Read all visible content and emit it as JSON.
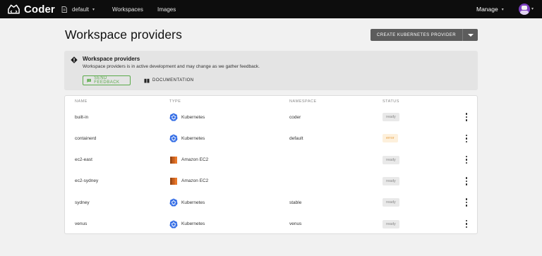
{
  "topbar": {
    "brand": "Coder",
    "org": "default",
    "nav": [
      "Workspaces",
      "Images"
    ],
    "manage": "Manage"
  },
  "header": {
    "title": "Workspace providers",
    "create_button": "CREATE KUBERNETES PROVIDER"
  },
  "alert": {
    "title": "Workspace providers",
    "body": "Workspace providers is in active development and may change as we gather feedback.",
    "feedback_button": "SEND FEEDBACK",
    "docs_button": "DOCUMENTATION"
  },
  "table": {
    "columns": [
      "NAME",
      "TYPE",
      "NAMESPACE",
      "STATUS"
    ],
    "rows": [
      {
        "name": "built-in",
        "type": "Kubernetes",
        "icon": "kubernetes-icon",
        "namespace": "coder",
        "status": "ready"
      },
      {
        "name": "containerd",
        "type": "Kubernetes",
        "icon": "kubernetes-icon",
        "namespace": "default",
        "status": "error"
      },
      {
        "name": "ec2-east",
        "type": "Amazon EC2",
        "icon": "amazon-ec2-icon",
        "namespace": "",
        "status": "ready"
      },
      {
        "name": "ec2-sydney",
        "type": "Amazon EC2",
        "icon": "amazon-ec2-icon",
        "namespace": "",
        "status": "ready"
      },
      {
        "name": "sydney",
        "type": "Kubernetes",
        "icon": "kubernetes-icon",
        "namespace": "stable",
        "status": "ready"
      },
      {
        "name": "venus",
        "type": "Kubernetes",
        "icon": "kubernetes-icon",
        "namespace": "venus",
        "status": "ready"
      }
    ]
  },
  "colors": {
    "topbar": "#0d0d0d",
    "primary_button": "#5c5c5c",
    "feedback_green": "#5aaa4a",
    "error": "#e8a24a",
    "kubernetes": "#326ce5",
    "ec2": "#e8782a"
  }
}
